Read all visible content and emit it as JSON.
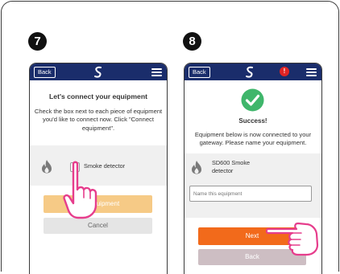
{
  "steps": [
    "7",
    "8"
  ],
  "left_screen": {
    "back_label": "Back",
    "title": "Let's connect your equipment",
    "instructions": "Check the box next to each piece of equipment you'd like to connect now. Click \"Connect equipment\".",
    "item": {
      "icon": "flame-icon",
      "label": "Smoke detector",
      "checked": false
    },
    "connect_button_label": "equipment",
    "cancel_button_label": "Cancel",
    "colors": {
      "header": "#1a2d6b",
      "connect": "#f6ca86",
      "cancel": "#e5e5e5"
    }
  },
  "right_screen": {
    "back_label": "Back",
    "alert_badge": "!",
    "success_title": "Success!",
    "message": "Equipment below is now connected to your gateway. Please name your equipment.",
    "device": {
      "icon": "flame-icon",
      "name": "SD600 Smoke detector"
    },
    "name_input": {
      "placeholder": "Name this equipment",
      "value": ""
    },
    "next_button_label": "Next",
    "back_button_label": "Back",
    "colors": {
      "success": "#3fb66b",
      "next": "#f26a1b",
      "back_btn": "#cdbec3"
    }
  }
}
